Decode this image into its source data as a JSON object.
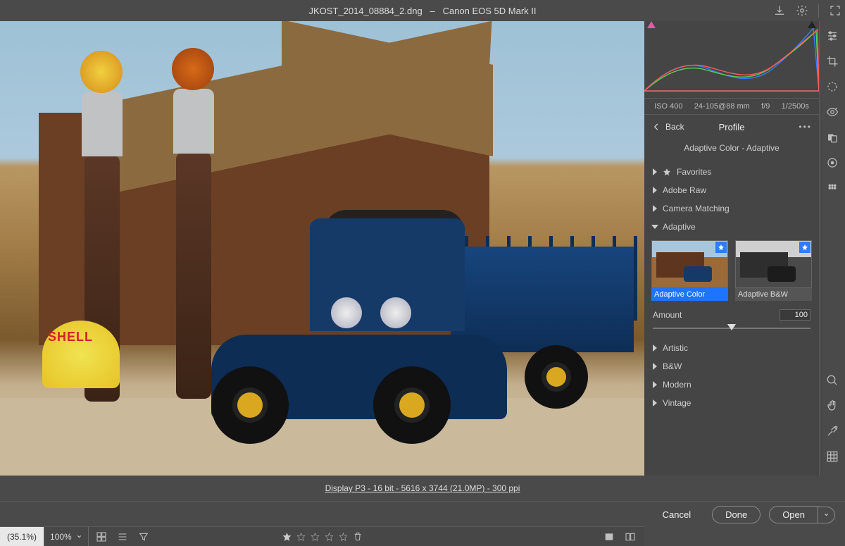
{
  "title": "JKOST_2014_08884_2.dng   –   Canon EOS 5D Mark II",
  "exposure": {
    "iso": "ISO 400",
    "lens": "24-105@88 mm",
    "aperture": "f/9",
    "shutter": "1/2500s"
  },
  "panel": {
    "back": "Back",
    "title": "Profile",
    "current": "Adaptive Color - Adaptive",
    "sections": {
      "favorites": "Favorites",
      "adobe_raw": "Adobe Raw",
      "camera_matching": "Camera Matching",
      "adaptive": "Adaptive",
      "artistic": "Artistic",
      "bw": "B&W",
      "modern": "Modern",
      "vintage": "Vintage"
    },
    "thumbs": {
      "adaptive_color": "Adaptive Color",
      "adaptive_bw": "Adaptive B&W"
    },
    "amount_label": "Amount",
    "amount_value": "100"
  },
  "toolbar": {
    "zoom_label": "(35.1%)",
    "zoom_select": "100%",
    "rating": 1
  },
  "info_line": "Display P3 - 16 bit - 5616 x 3744 (21.0MP) - 300 ppi",
  "footer": {
    "cancel": "Cancel",
    "done": "Done",
    "open": "Open"
  },
  "decor": {
    "shell_label": "SHELL"
  }
}
